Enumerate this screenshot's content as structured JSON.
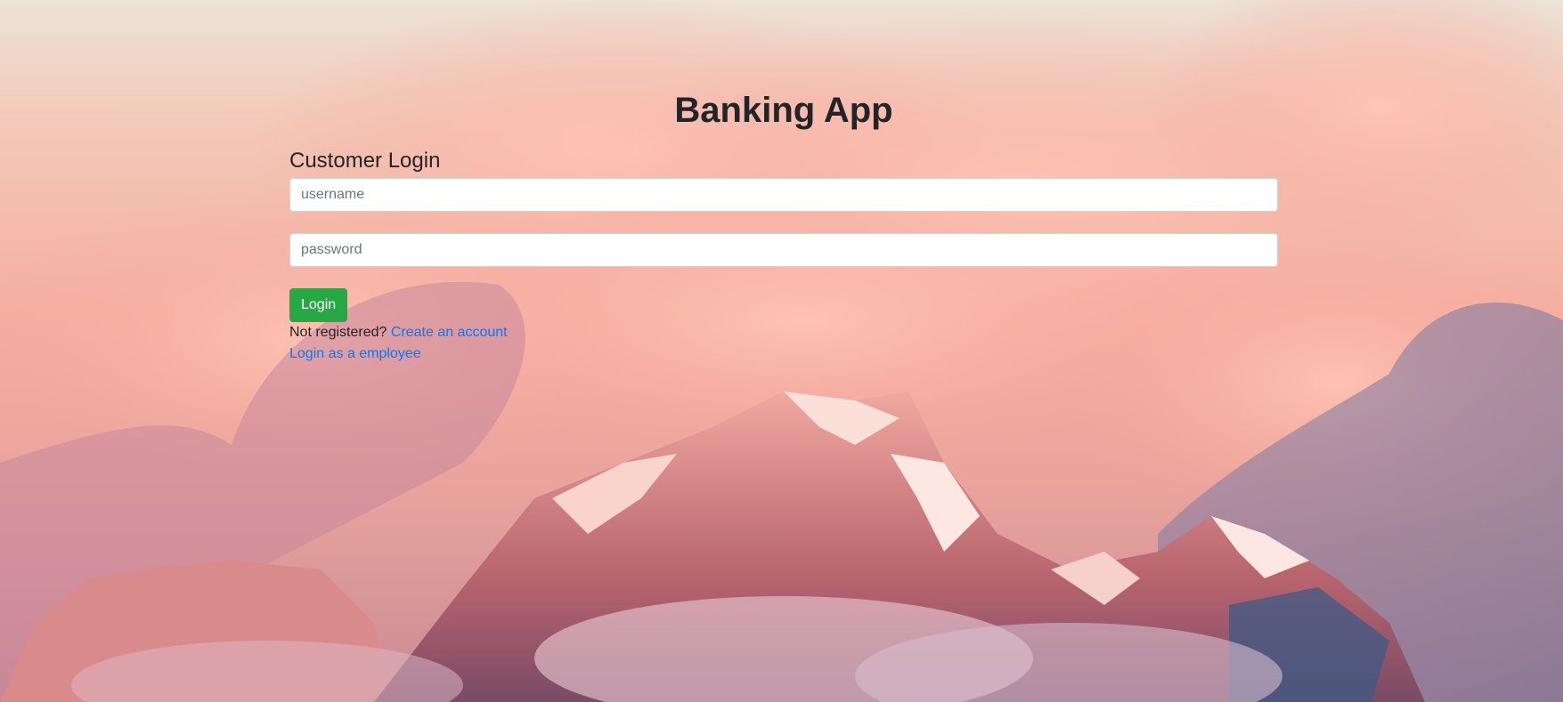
{
  "header": {
    "title": "Banking App"
  },
  "login": {
    "heading": "Customer Login",
    "username_placeholder": "username",
    "password_placeholder": "password",
    "login_label": "Login",
    "not_registered_text": "Not registered?",
    "create_account_label": "Create an account",
    "employee_login_label": "Login as a employee"
  },
  "colors": {
    "accent_green": "#28a745",
    "link_blue": "#007bff",
    "text_dark": "#212529"
  }
}
